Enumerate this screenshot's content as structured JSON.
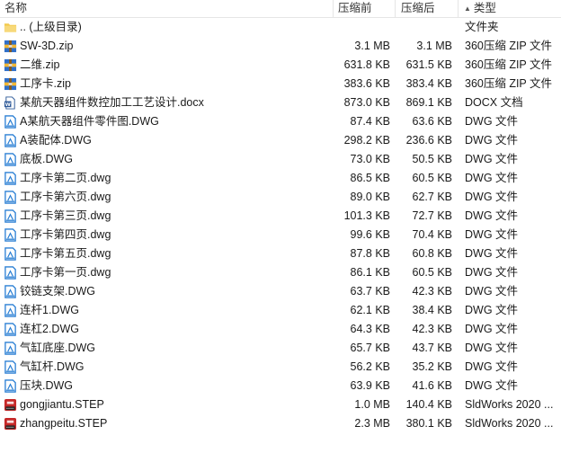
{
  "header": {
    "name": "名称",
    "size": "压缩前",
    "packed": "压缩后",
    "type": "类型",
    "sort_icon": "sort-ascending-icon"
  },
  "files": [
    {
      "name": ".. (上级目录)",
      "size": "",
      "packed": "",
      "type": "文件夹",
      "icon": "folder-icon"
    },
    {
      "name": "SW-3D.zip",
      "size": "3.1 MB",
      "packed": "3.1 MB",
      "type": "360压缩 ZIP 文件",
      "icon": "zip-archive-icon"
    },
    {
      "name": "二维.zip",
      "size": "631.8 KB",
      "packed": "631.5 KB",
      "type": "360压缩 ZIP 文件",
      "icon": "zip-archive-icon"
    },
    {
      "name": "工序卡.zip",
      "size": "383.6 KB",
      "packed": "383.4 KB",
      "type": "360压缩 ZIP 文件",
      "icon": "zip-archive-icon"
    },
    {
      "name": "某航天器组件数控加工工艺设计.docx",
      "size": "873.0 KB",
      "packed": "869.1 KB",
      "type": "DOCX 文档",
      "icon": "word-document-icon"
    },
    {
      "name": "A某航天器组件零件图.DWG",
      "size": "87.4 KB",
      "packed": "63.6 KB",
      "type": "DWG 文件",
      "icon": "dwg-file-icon"
    },
    {
      "name": "A装配体.DWG",
      "size": "298.2 KB",
      "packed": "236.6 KB",
      "type": "DWG 文件",
      "icon": "dwg-file-icon"
    },
    {
      "name": "底板.DWG",
      "size": "73.0 KB",
      "packed": "50.5 KB",
      "type": "DWG 文件",
      "icon": "dwg-file-icon"
    },
    {
      "name": "工序卡第二页.dwg",
      "size": "86.5 KB",
      "packed": "60.5 KB",
      "type": "DWG 文件",
      "icon": "dwg-file-icon"
    },
    {
      "name": "工序卡第六页.dwg",
      "size": "89.0 KB",
      "packed": "62.7 KB",
      "type": "DWG 文件",
      "icon": "dwg-file-icon"
    },
    {
      "name": "工序卡第三页.dwg",
      "size": "101.3 KB",
      "packed": "72.7 KB",
      "type": "DWG 文件",
      "icon": "dwg-file-icon"
    },
    {
      "name": "工序卡第四页.dwg",
      "size": "99.6 KB",
      "packed": "70.4 KB",
      "type": "DWG 文件",
      "icon": "dwg-file-icon"
    },
    {
      "name": "工序卡第五页.dwg",
      "size": "87.8 KB",
      "packed": "60.8 KB",
      "type": "DWG 文件",
      "icon": "dwg-file-icon"
    },
    {
      "name": "工序卡第一页.dwg",
      "size": "86.1 KB",
      "packed": "60.5 KB",
      "type": "DWG 文件",
      "icon": "dwg-file-icon"
    },
    {
      "name": "铰链支架.DWG",
      "size": "63.7 KB",
      "packed": "42.3 KB",
      "type": "DWG 文件",
      "icon": "dwg-file-icon"
    },
    {
      "name": "连杆1.DWG",
      "size": "62.1 KB",
      "packed": "38.4 KB",
      "type": "DWG 文件",
      "icon": "dwg-file-icon"
    },
    {
      "name": "连杠2.DWG",
      "size": "64.3 KB",
      "packed": "42.3 KB",
      "type": "DWG 文件",
      "icon": "dwg-file-icon"
    },
    {
      "name": "气缸底座.DWG",
      "size": "65.7 KB",
      "packed": "43.7 KB",
      "type": "DWG 文件",
      "icon": "dwg-file-icon"
    },
    {
      "name": "气缸杆.DWG",
      "size": "56.2 KB",
      "packed": "35.2 KB",
      "type": "DWG 文件",
      "icon": "dwg-file-icon"
    },
    {
      "name": "压块.DWG",
      "size": "63.9 KB",
      "packed": "41.6 KB",
      "type": "DWG 文件",
      "icon": "dwg-file-icon"
    },
    {
      "name": "gongjiantu.STEP",
      "size": "1.0 MB",
      "packed": "140.4 KB",
      "type": "SldWorks 2020 ...",
      "icon": "solidworks-step-icon"
    },
    {
      "name": "zhangpeitu.STEP",
      "size": "2.3 MB",
      "packed": "380.1 KB",
      "type": "SldWorks 2020 ...",
      "icon": "solidworks-step-icon"
    }
  ],
  "colors": {
    "folder": "#f2c94c",
    "zip_blue": "#2f6fc9",
    "zip_yellow": "#f2b632",
    "dwg": "#2a7fd4",
    "word": "#2b5797",
    "step_red": "#c62828"
  }
}
